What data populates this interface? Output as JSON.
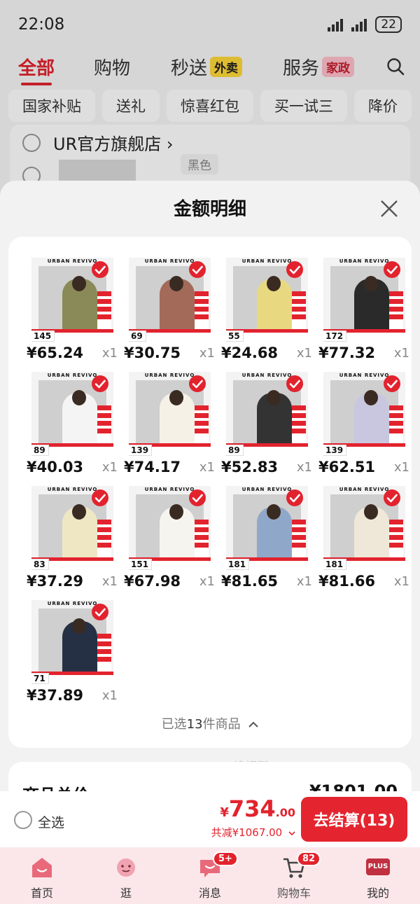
{
  "status": {
    "time": "22:08",
    "battery": "22"
  },
  "tabs": [
    {
      "label": "全部"
    },
    {
      "label": "购物"
    },
    {
      "label": "秒送",
      "tag": "外卖"
    },
    {
      "label": "服务",
      "tag": "家政"
    }
  ],
  "chips": [
    "国家补贴",
    "送礼",
    "惊喜红包",
    "买一试三",
    "降价"
  ],
  "store": {
    "name": "UR官方旗舰店",
    "chevron": "›",
    "item_color": "黑色"
  },
  "sheet": {
    "title": "金额明细"
  },
  "products": {
    "brand": "URBAN REVIVO",
    "items": [
      {
        "price": "¥65.24",
        "qty": "x1",
        "badge": "145",
        "color": "#8a8a58"
      },
      {
        "price": "¥30.75",
        "qty": "x1",
        "badge": "69",
        "color": "#a36a5a"
      },
      {
        "price": "¥24.68",
        "qty": "x1",
        "badge": "55",
        "color": "#e8d980"
      },
      {
        "price": "¥77.32",
        "qty": "x1",
        "badge": "172",
        "color": "#2a2a2a"
      },
      {
        "price": "¥40.03",
        "qty": "x1",
        "badge": "89",
        "color": "#f4f4f4"
      },
      {
        "price": "¥74.17",
        "qty": "x1",
        "badge": "139",
        "color": "#f5f1e6"
      },
      {
        "price": "¥52.83",
        "qty": "x1",
        "badge": "89",
        "color": "#333333"
      },
      {
        "price": "¥62.51",
        "qty": "x1",
        "badge": "139",
        "color": "#c9c6e0"
      },
      {
        "price": "¥37.29",
        "qty": "x1",
        "badge": "83",
        "color": "#efe7c4"
      },
      {
        "price": "¥67.98",
        "qty": "x1",
        "badge": "151",
        "color": "#f6f4ee"
      },
      {
        "price": "¥81.65",
        "qty": "x1",
        "badge": "181",
        "color": "#8fa8c9"
      },
      {
        "price": "¥81.66",
        "qty": "x1",
        "badge": "181",
        "color": "#efe8d8"
      },
      {
        "price": "¥37.89",
        "qty": "x1",
        "badge": "71",
        "color": "#253045"
      }
    ]
  },
  "selected": {
    "prefix": "已选",
    "count": "13",
    "suffix": "件商品"
  },
  "watermark": "线报酷-new.xianbao.fun",
  "total": {
    "label": "商品总价",
    "value": "¥1801.00"
  },
  "checkout": {
    "select_all": "全选",
    "yen": "¥",
    "amount_int": "734",
    "amount_dec": ".00",
    "discount": "共减¥1067.00",
    "button": "去结算(13)"
  },
  "nav": [
    {
      "label": "首页",
      "icon": "home-icon"
    },
    {
      "label": "逛",
      "icon": "browse-icon"
    },
    {
      "label": "消息",
      "icon": "message-icon",
      "badge": "5+"
    },
    {
      "label": "购物车",
      "icon": "cart-icon",
      "badge": "82"
    },
    {
      "label": "我的",
      "icon": "plus-member-icon",
      "plus": "PLUS"
    }
  ],
  "colors": {
    "accent": "#e2232e",
    "nav_bg": "#fbe7ea"
  }
}
